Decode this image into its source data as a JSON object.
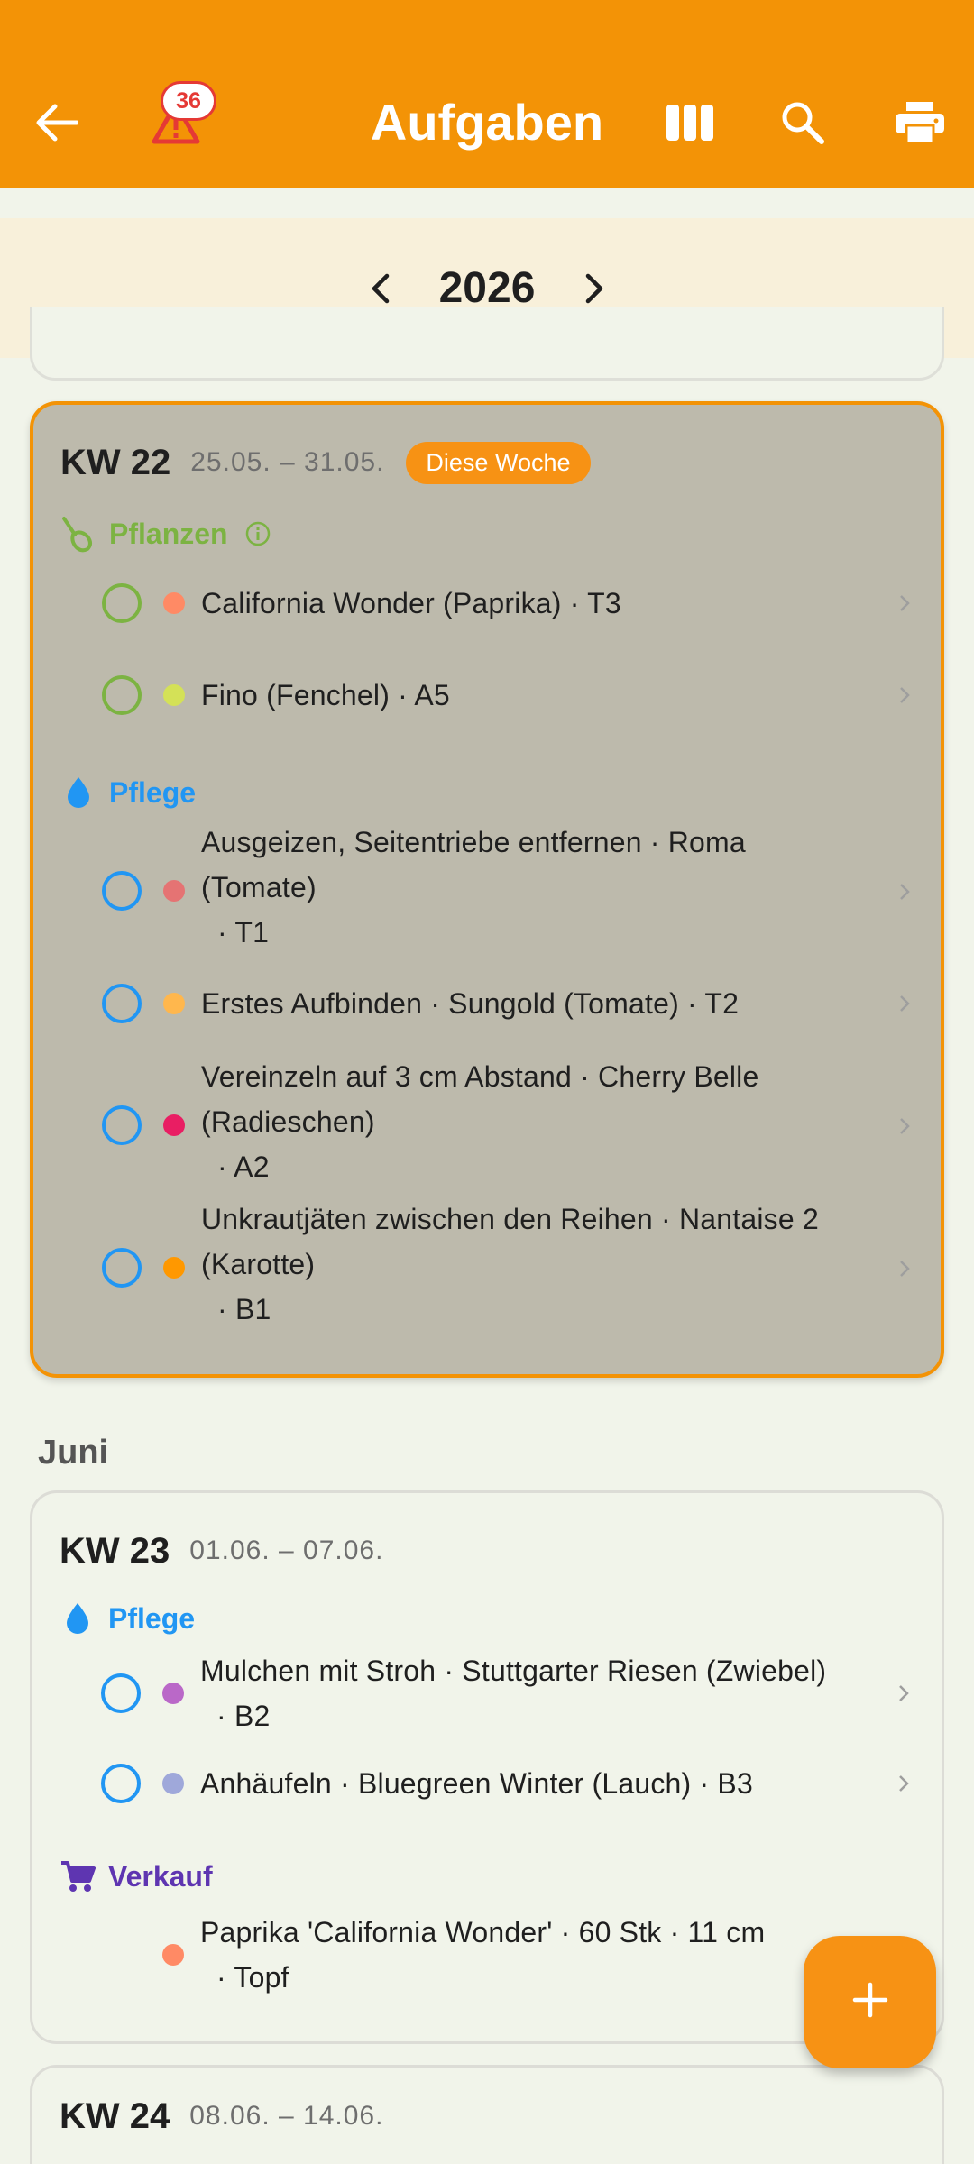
{
  "appbar": {
    "title": "Aufgaben",
    "warning_count": "36",
    "icons": [
      "back-arrow-icon",
      "warning-icon",
      "columns-icon",
      "search-icon",
      "print-icon"
    ],
    "color": "#f39306"
  },
  "year_nav": {
    "year": "2026"
  },
  "weeks": [
    {
      "kw": "KW 22",
      "range": "25.05. – 31.05.",
      "badge": "Diese Woche",
      "sections": [
        {
          "title": "Pflanzen",
          "icon": "plant-icon",
          "tasks": [
            {
              "line1": "California Wonder (Paprika)  · T3",
              "dot": "#ff8a65"
            },
            {
              "line1": "Fino (Fenchel)  · A5",
              "dot": "#d4e157"
            }
          ]
        },
        {
          "title": "Pflege",
          "icon": "water-drop-icon",
          "tasks": [
            {
              "line1": "Ausgeizen, Seitentriebe entfernen · Roma",
              "line2": "(Tomate)",
              "line3": "· T1",
              "dot": "#e57373"
            },
            {
              "line1": "Erstes Aufbinden · Sungold (Tomate)  · T2",
              "dot": "#ffb74d"
            },
            {
              "line1": "Vereinzeln auf 3 cm Abstand · Cherry Belle",
              "line2": "(Radieschen)",
              "line3": "· A2",
              "dot": "#e91e63"
            },
            {
              "line1": "Unkrautjäten zwischen den Reihen · Nantaise 2",
              "line2": "(Karotte)",
              "line3": "· B1",
              "dot": "#ff9800"
            }
          ]
        }
      ]
    },
    {
      "month": "Juni",
      "kw": "KW 23",
      "range": "01.06. – 07.06.",
      "sections": [
        {
          "title": "Pflege",
          "icon": "water-drop-icon",
          "tasks": [
            {
              "line1": "Mulchen mit Stroh · Stuttgarter Riesen (Zwiebel)",
              "line2": "· B2",
              "dot": "#ba68c8"
            },
            {
              "line1": "Anhäufeln · Bluegreen Winter (Lauch)  · B3",
              "dot": "#9fa8da"
            }
          ]
        },
        {
          "title": "Verkauf",
          "icon": "cart-icon",
          "tasks": [
            {
              "line1": "Paprika 'California Wonder' · 60 Stk · 11 cm",
              "line2": "· Topf",
              "dot": "#ff8a65"
            }
          ]
        }
      ]
    },
    {
      "kw": "KW 24",
      "range": "08.06. – 14.06."
    }
  ],
  "fab": {
    "icon": "plus-icon"
  }
}
